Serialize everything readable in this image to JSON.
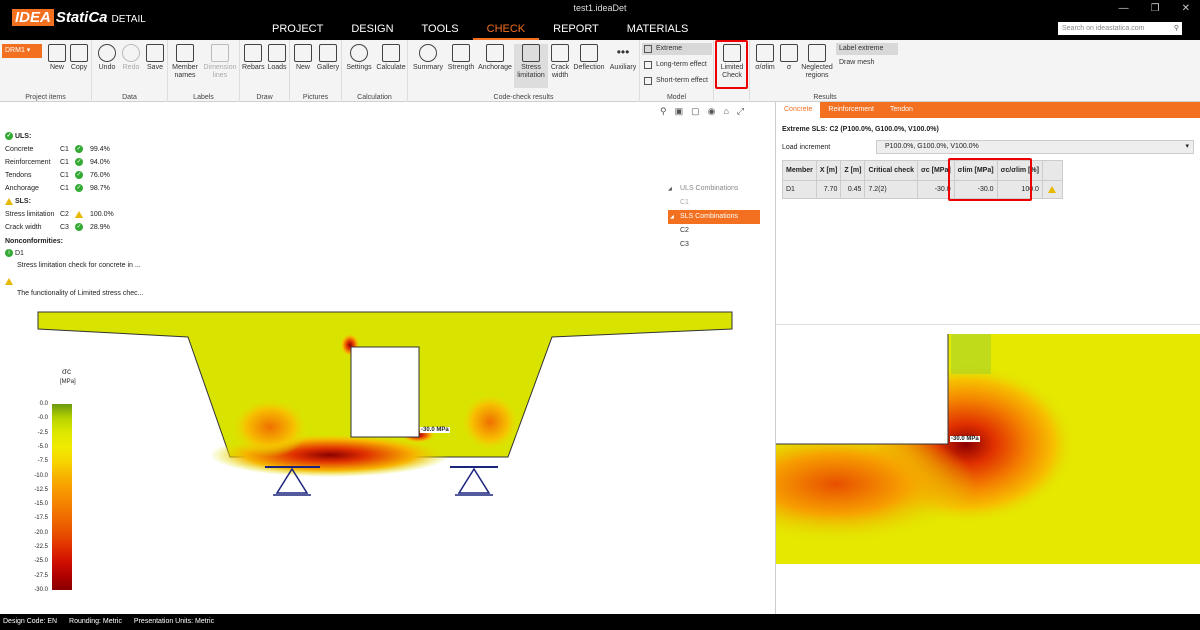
{
  "app": {
    "logo_mark": "IDEA",
    "logo_name": "StatiCa",
    "logo_sub": "DETAIL",
    "doc_title": "test1.ideaDet",
    "search_placeholder": "Search on ideastatica.com",
    "menu": [
      "PROJECT",
      "DESIGN",
      "TOOLS",
      "CHECK",
      "REPORT",
      "MATERIALS"
    ],
    "active_menu": "CHECK"
  },
  "ribbon": {
    "drm": "DRM1",
    "groups": {
      "project": {
        "label": "Project items",
        "buttons": [
          "New",
          "Copy"
        ]
      },
      "data": {
        "label": "Data",
        "buttons": [
          "Undo",
          "Redo",
          "Save"
        ]
      },
      "labels": {
        "label": "Labels",
        "buttons": [
          "Member names",
          "Dimension lines"
        ]
      },
      "draw": {
        "label": "Draw",
        "buttons": [
          "Rebars",
          "Loads"
        ]
      },
      "pictures": {
        "label": "Pictures",
        "buttons": [
          "New",
          "Gallery"
        ]
      },
      "calculation": {
        "label": "Calculation",
        "buttons": [
          "Settings",
          "Calculate"
        ]
      },
      "codecheck": {
        "label": "Code-check results",
        "buttons": [
          "Summary",
          "Strength",
          "Anchorage",
          "Stress limitation",
          "Crack width",
          "Deflection",
          "Auxiliary"
        ]
      },
      "model": {
        "label": "Model",
        "options": [
          "Extreme",
          "Long-term effect",
          "Short-term effect"
        ]
      },
      "limited": {
        "button": "Limited Check"
      },
      "results": {
        "label": "Results",
        "buttons": [
          "σ/σlim",
          "σ",
          "Neglected regions"
        ],
        "options": [
          "Label extreme",
          "Draw mesh"
        ]
      }
    }
  },
  "summary": {
    "uls_title": "ULS:",
    "uls": [
      {
        "name": "Concrete",
        "combo": "C1",
        "value": "99.4%"
      },
      {
        "name": "Reinforcement",
        "combo": "C1",
        "value": "94.0%"
      },
      {
        "name": "Tendons",
        "combo": "C1",
        "value": "76.0%"
      },
      {
        "name": "Anchorage",
        "combo": "C1",
        "value": "98.7%"
      }
    ],
    "sls_title": "SLS:",
    "sls": [
      {
        "name": "Stress limitation",
        "combo": "C2",
        "value": "100.0%"
      },
      {
        "name": "Crack width",
        "combo": "C3",
        "value": "28.9%"
      }
    ],
    "nonconf_title": "Nonconformities:",
    "nonconf_member": "D1",
    "nonconf_text1": "Stress limitation check for concrete in ...",
    "nonconf_text2": "The functionality of Limited stress chec..."
  },
  "combos": {
    "uls_header": "ULS Combinations",
    "uls_items": [
      "C1"
    ],
    "sls_header": "SLS Combinations",
    "sls_items": [
      "C2",
      "C3"
    ]
  },
  "legend": {
    "title": "σc",
    "unit": "[MPa]",
    "ticks": [
      "0.0",
      "-0.0",
      "-2.5",
      "-5.0",
      "-7.5",
      "-10.0",
      "-12.5",
      "-15.0",
      "-17.5",
      "-20.0",
      "-22.5",
      "-25.0",
      "-27.5",
      "-30.0"
    ],
    "colors": [
      "#6a9a10",
      "#b8d400",
      "#dde800",
      "#f0ea00",
      "#f7d600",
      "#f7b400",
      "#f79a00",
      "#f48200",
      "#ef6a00",
      "#e85000",
      "#e03000",
      "#d01000",
      "#b00000",
      "#8a0000"
    ]
  },
  "canvas": {
    "extreme_label": "-30.0 MPa",
    "zoom_label": "-30.0 MPa"
  },
  "right": {
    "tabs": [
      "Concrete",
      "Reinforcement",
      "Tendon"
    ],
    "active_tab": "Concrete",
    "title": "Extreme SLS: C2 (P100.0%, G100.0%, V100.0%)",
    "load_increment_label": "Load increment",
    "load_increment_value": "P100.0%, G100.0%, V100.0%",
    "table": {
      "headers": [
        "Member",
        "X [m]",
        "Z [m]",
        "Critical check",
        "σc [MPa]",
        "σlim [MPa]",
        "σc/σlim [%]",
        ""
      ],
      "rows": [
        [
          "D1",
          "7.70",
          "0.45",
          "7.2(2)",
          "-30.0",
          "-30.0",
          "100.0",
          "⚠"
        ]
      ]
    }
  },
  "status": {
    "design_code": "Design Code: EN",
    "rounding": "Rounding: Metric",
    "units": "Presentation Units: Metric"
  }
}
